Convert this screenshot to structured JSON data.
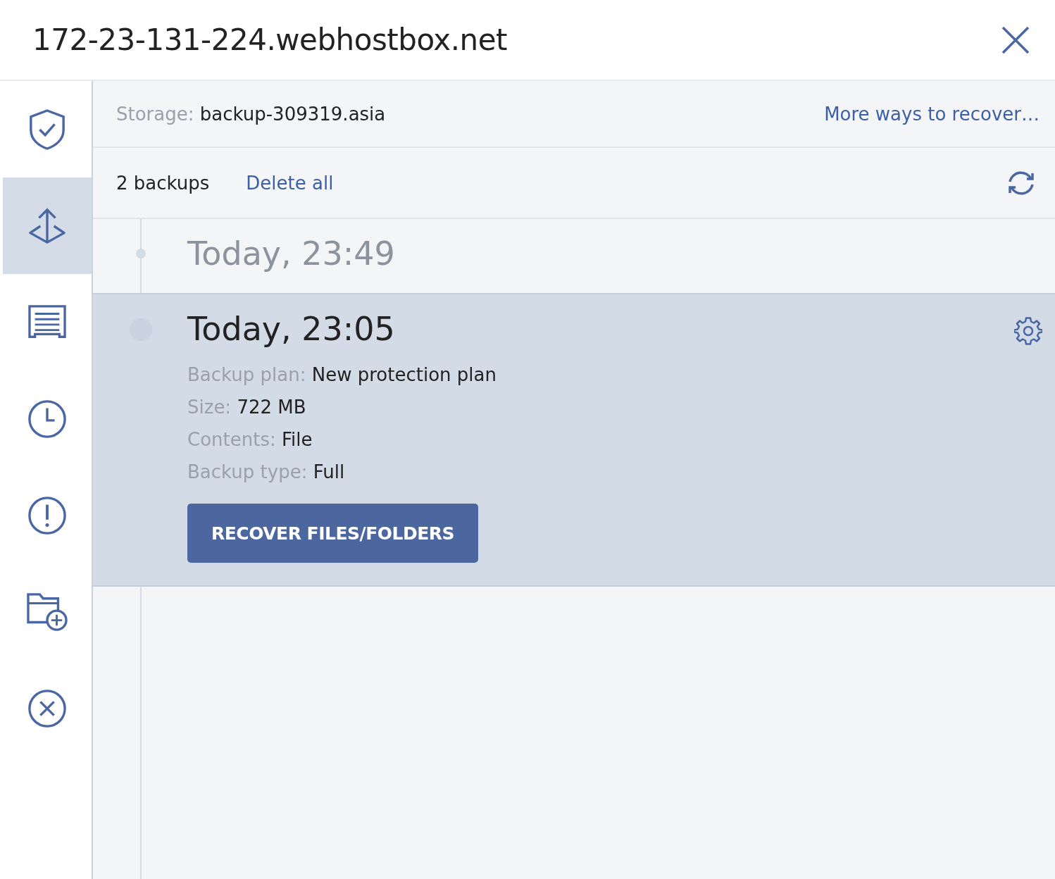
{
  "window": {
    "title": "172-23-131-224.webhostbox.net"
  },
  "sidebar": {
    "items": [
      {
        "kind": "shield",
        "selected": false
      },
      {
        "kind": "recovery",
        "selected": true
      },
      {
        "kind": "activities",
        "selected": false
      },
      {
        "kind": "clock",
        "selected": false
      },
      {
        "kind": "alert",
        "selected": false
      },
      {
        "kind": "folder-add",
        "selected": false
      },
      {
        "kind": "cancel",
        "selected": false
      }
    ]
  },
  "storage": {
    "label": "Storage:",
    "value": "backup-309319.asia",
    "link": "More ways to recover…"
  },
  "backups": {
    "count": "2 backups",
    "delete_all": "Delete all"
  },
  "backup_points": [
    {
      "time": "Today, 23:49",
      "selected": false
    },
    {
      "time": "Today, 23:05",
      "selected": true,
      "details": [
        {
          "label": "Backup plan:",
          "value": "New protection plan"
        },
        {
          "label": "Size:",
          "value": "722 MB"
        },
        {
          "label": "Contents:",
          "value": "File"
        },
        {
          "label": "Backup type:",
          "value": "Full"
        }
      ],
      "action": "RECOVER FILES/FOLDERS"
    }
  ]
}
